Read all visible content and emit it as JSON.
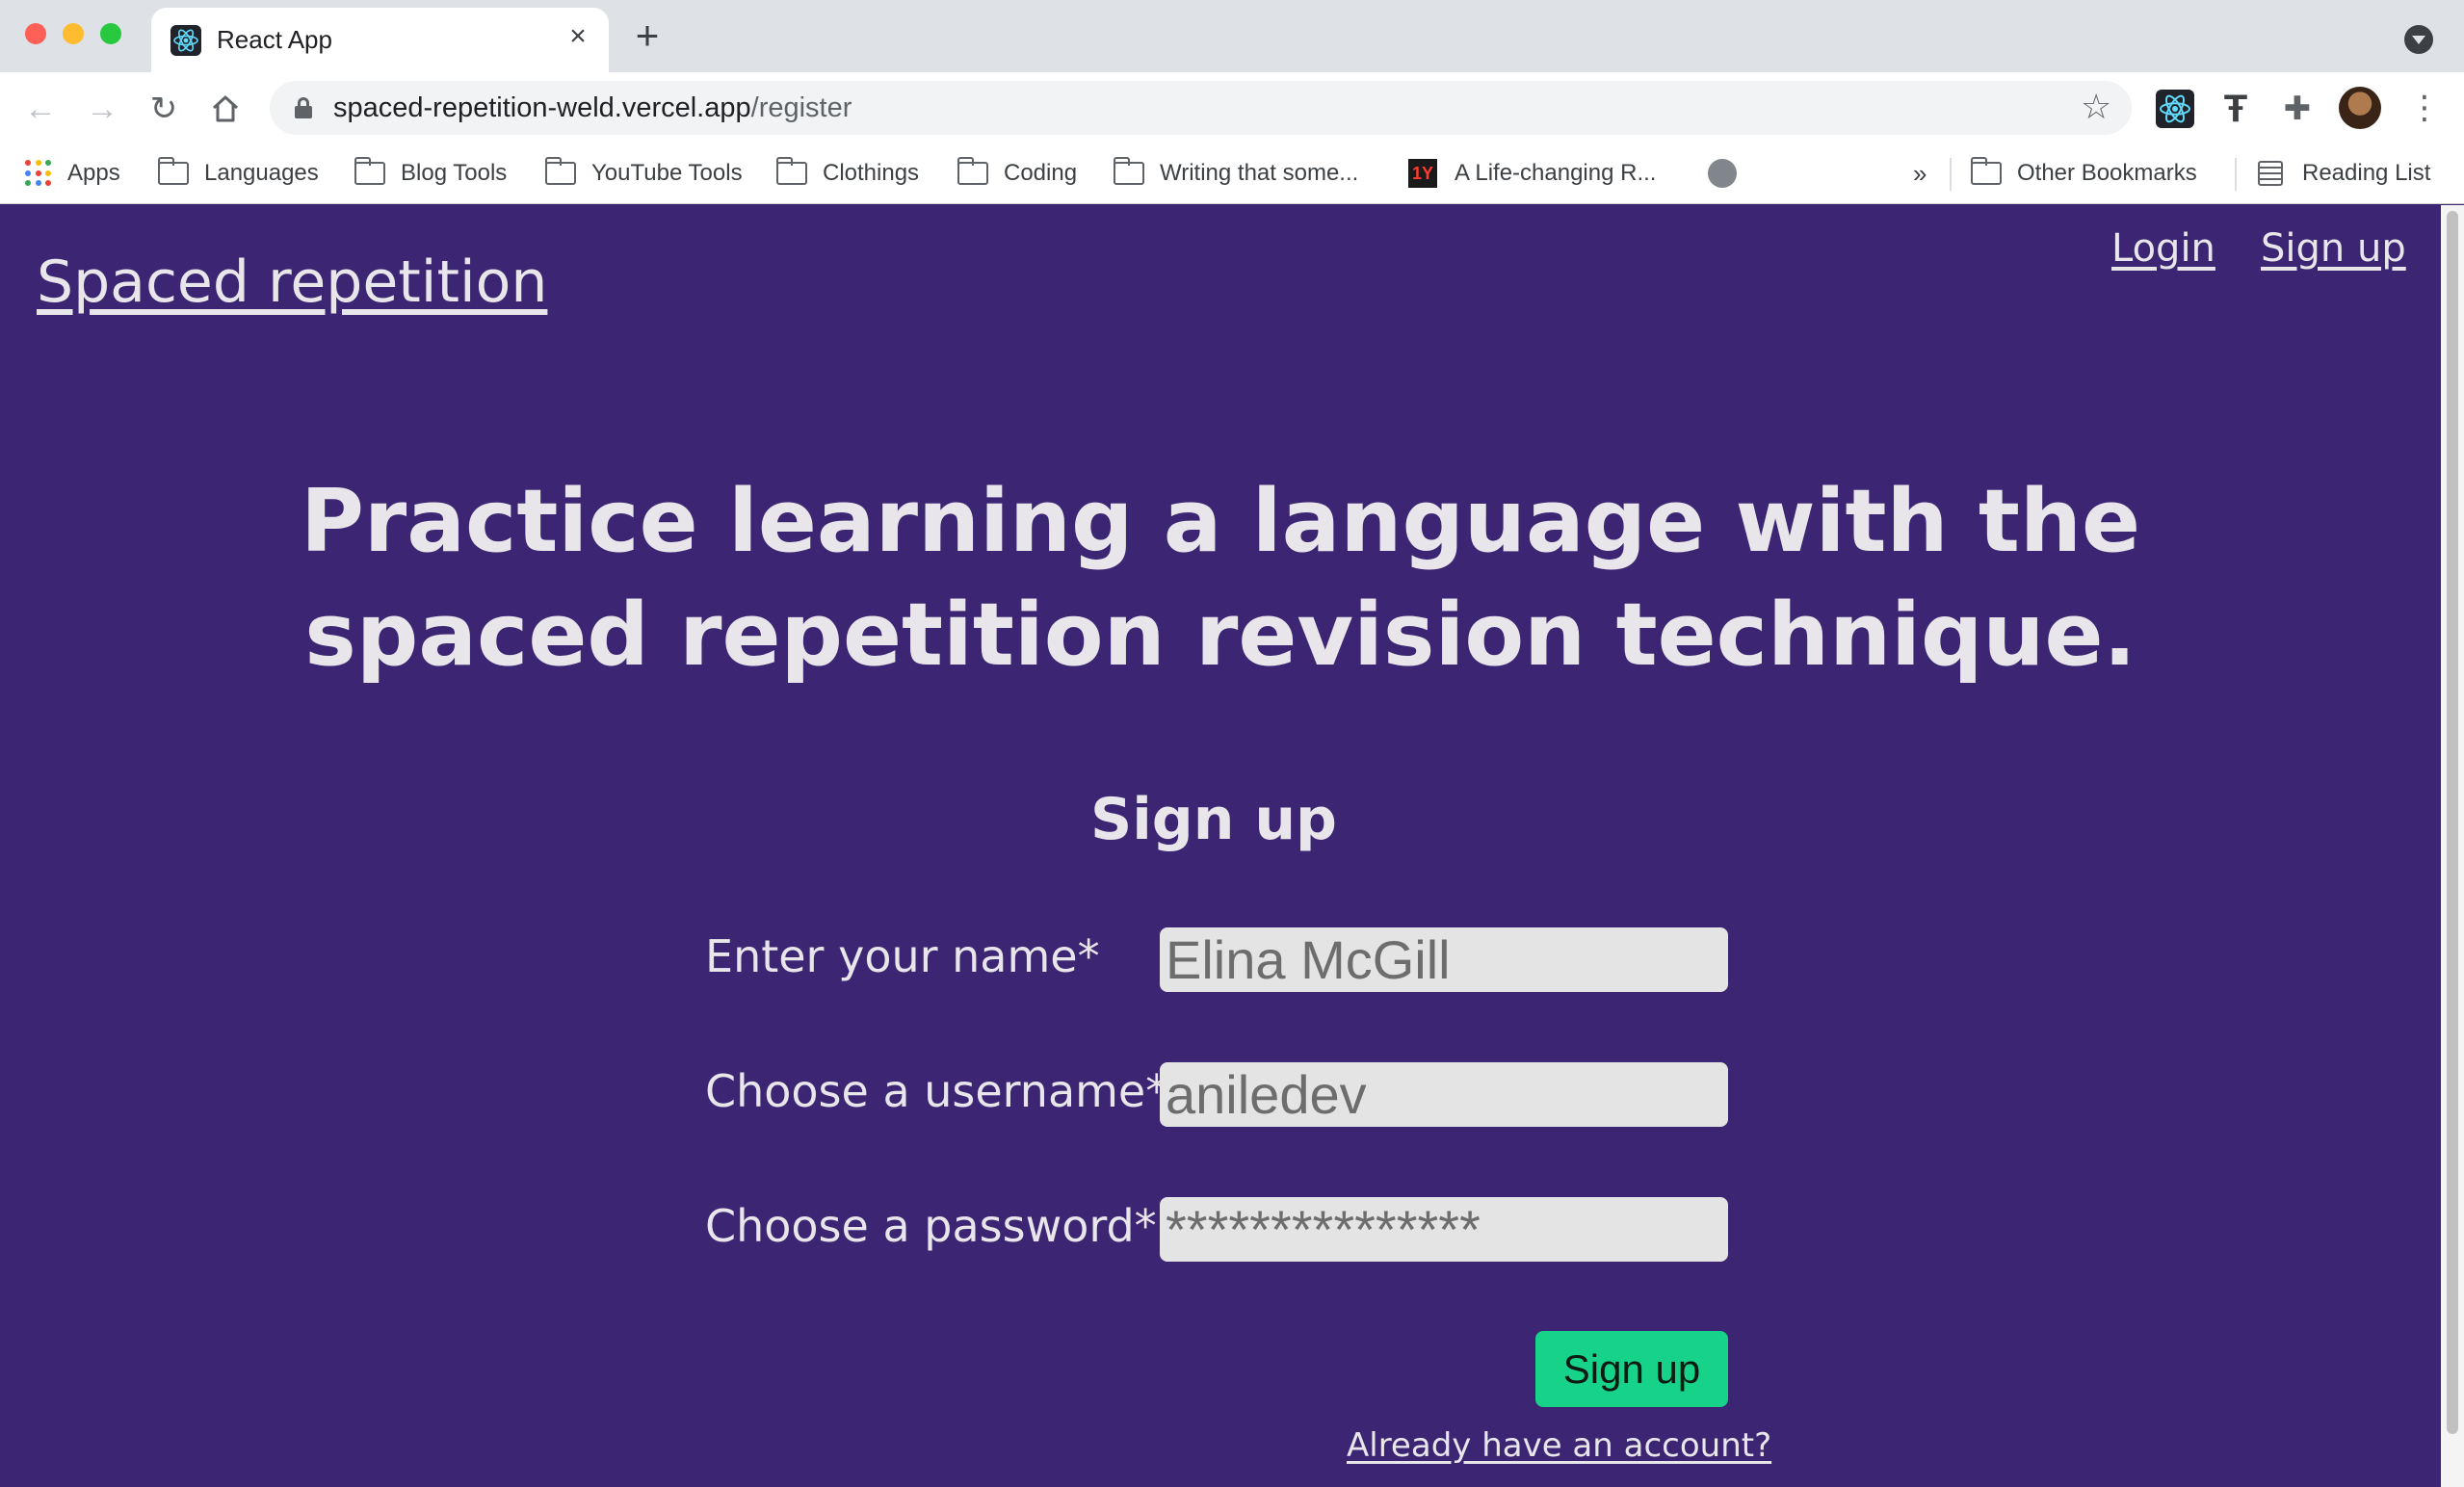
{
  "browser": {
    "tab": {
      "title": "React App",
      "favicon": "react-icon"
    },
    "address_bar": {
      "host": "spaced-repetition-weld.vercel.app",
      "path": "/register"
    },
    "bookmarks": [
      {
        "label": "Apps",
        "icon": "apps-grid-icon"
      },
      {
        "label": "Languages",
        "icon": "folder-icon"
      },
      {
        "label": "Blog Tools",
        "icon": "folder-icon"
      },
      {
        "label": "YouTube Tools",
        "icon": "folder-icon"
      },
      {
        "label": "Clothings",
        "icon": "folder-icon"
      },
      {
        "label": "Coding",
        "icon": "folder-icon"
      },
      {
        "label": "Writing that some...",
        "icon": "folder-icon"
      },
      {
        "label": "A Life-changing R...",
        "icon": "1y-icon"
      },
      {
        "label": "",
        "icon": "globe-icon"
      }
    ],
    "overflow_label": "»",
    "other_bookmarks": "Other Bookmarks",
    "reading_list": "Reading List"
  },
  "site": {
    "title": "Spaced repetition",
    "nav": {
      "login": "Login",
      "signup": "Sign up"
    }
  },
  "main": {
    "headline": "Practice learning a language with the spaced repetition revision technique."
  },
  "form": {
    "title": "Sign up",
    "fields": {
      "name": {
        "label": "Enter your name*",
        "value": "Elina McGill"
      },
      "username": {
        "label": "Choose a username*",
        "value": "aniledev"
      },
      "password": {
        "label": "Choose a password*",
        "value": "***************"
      }
    },
    "submit_label": "Sign up",
    "login_link": "Already have an account?"
  },
  "colors": {
    "page_background": "#3c2572",
    "text": "#e8e6ea",
    "button": "#17d289",
    "input_background": "#e4e4e4"
  }
}
